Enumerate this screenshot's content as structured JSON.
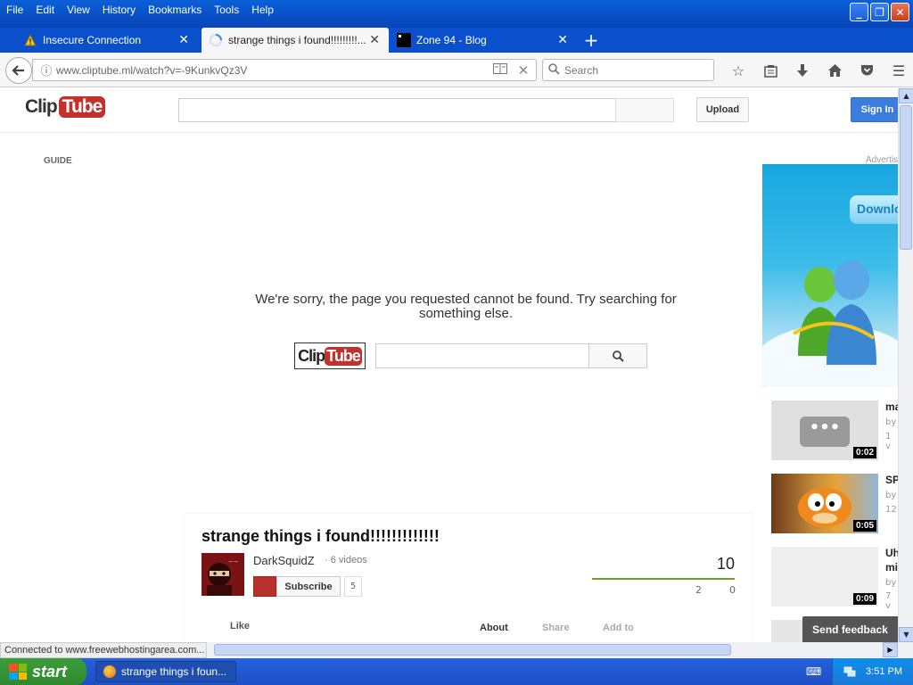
{
  "menubar": {
    "items": [
      "File",
      "Edit",
      "View",
      "History",
      "Bookmarks",
      "Tools",
      "Help"
    ]
  },
  "tabs": [
    {
      "label": "Insecure Connection",
      "icon": "warning-icon"
    },
    {
      "label": "strange things i found!!!!!!!!!...",
      "icon": "loading-icon"
    },
    {
      "label": "Zone 94 - Blog",
      "icon": "site-icon"
    }
  ],
  "navbar": {
    "url": "www.cliptube.ml/watch?v=-9KunkvQz3V",
    "search_placeholder": "Search"
  },
  "site": {
    "logo_clip": "Clip",
    "logo_tube": "Tube",
    "upload_label": "Upload",
    "signin_label": "Sign In",
    "guide_label": "GUIDE",
    "error_message": "We're sorry, the page you requested cannot be found. Try searching for something else.",
    "advert_label": "Advertis",
    "ad_button": "Downlo",
    "feedback_label": "Send feedback"
  },
  "related": [
    {
      "title": "ma",
      "by": "by",
      "views": "1 v",
      "duration": "0:02"
    },
    {
      "title": "SP",
      "by": "by",
      "views": "12",
      "duration": "0:05"
    },
    {
      "title": "Uh",
      "title2": "mi",
      "by": "by",
      "views": "7 v",
      "duration": "0:09"
    }
  ],
  "video": {
    "title": "strange things i found!!!!!!!!!!!!!",
    "channel": "DarkSquidZ",
    "video_count": "· 6 videos",
    "subscribe_label": "Subscribe",
    "subscriber_count": "5",
    "views": "10",
    "likes": "2",
    "dislikes": "0",
    "like_label": "Like",
    "about_label": "About",
    "share_label": "Share",
    "addto_label": "Add to"
  },
  "status": {
    "text": "Connected to www.freewebhostingarea.com..."
  },
  "taskbar": {
    "start_label": "start",
    "task_label": "strange things i foun...",
    "clock": "3:51 PM"
  },
  "colors": {
    "brand_red": "#c4302b",
    "signin_blue": "#3b7ddd",
    "xp_blue": "#245edb",
    "start_green": "#3c9c3c"
  }
}
